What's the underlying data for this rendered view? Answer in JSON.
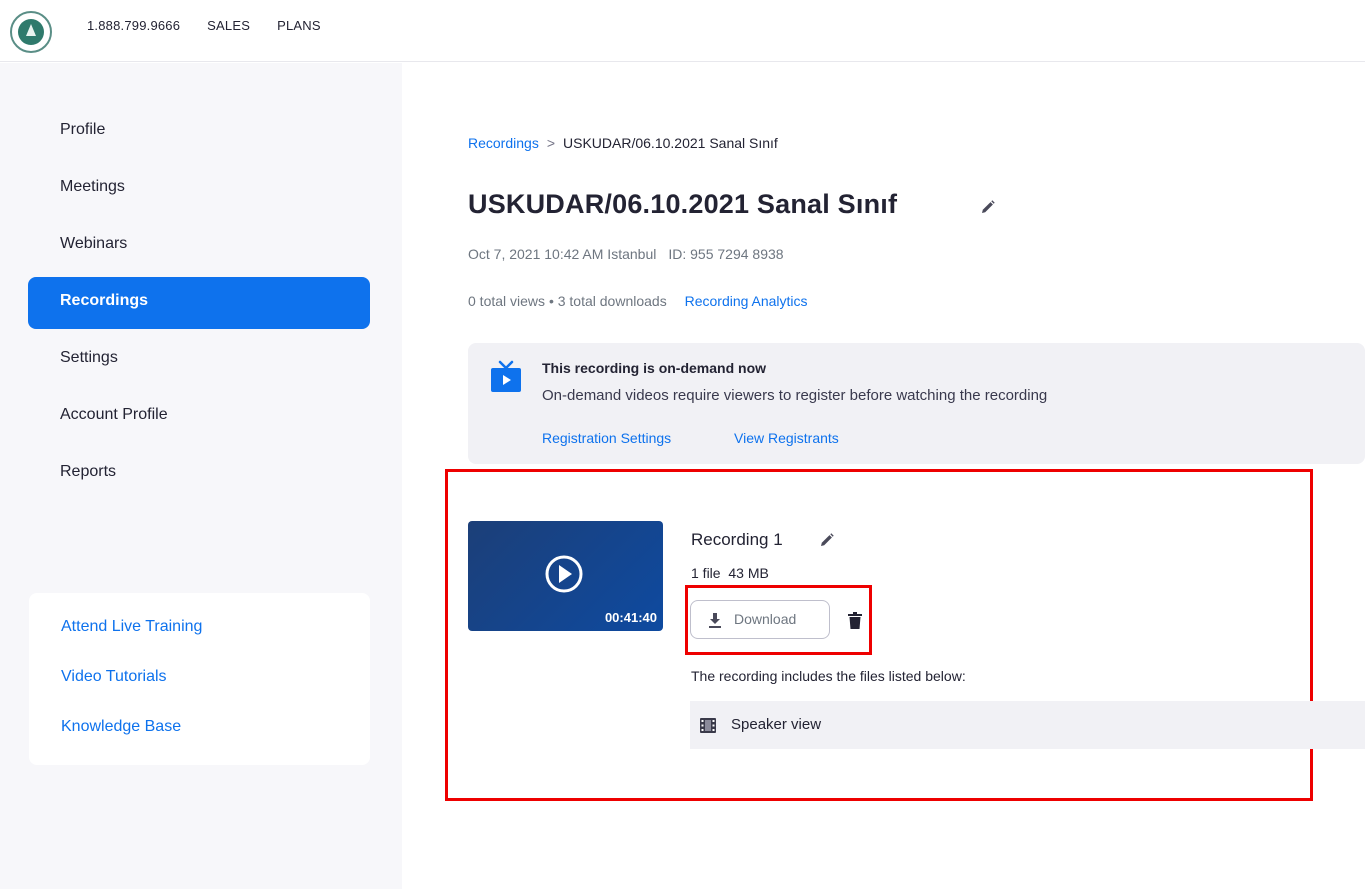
{
  "header": {
    "phone": "1.888.799.9666",
    "sales": "SALES",
    "plans": "PLANS"
  },
  "sidebar": {
    "items": [
      {
        "label": "Profile"
      },
      {
        "label": "Meetings"
      },
      {
        "label": "Webinars"
      },
      {
        "label": "Recordings",
        "active": true
      },
      {
        "label": "Settings"
      },
      {
        "label": "Account Profile"
      },
      {
        "label": "Reports"
      }
    ],
    "help_links": [
      {
        "label": "Attend Live Training"
      },
      {
        "label": "Video Tutorials"
      },
      {
        "label": "Knowledge Base"
      }
    ]
  },
  "breadcrumb": {
    "parent": "Recordings",
    "separator": ">",
    "current": "USKUDAR/06.10.2021 Sanal Sınıf"
  },
  "meeting": {
    "title": "USKUDAR/06.10.2021 Sanal Sınıf",
    "datetime": "Oct 7, 2021 10:42 AM Istanbul",
    "id_text": "ID: 955 7294 8938",
    "views": "0 total views",
    "bullet": "•",
    "downloads": "3 total downloads",
    "analytics_link": "Recording Analytics"
  },
  "on_demand": {
    "title": "This recording is on-demand now",
    "description": "On-demand videos require viewers to register before watching the recording",
    "registration_settings": "Registration Settings",
    "view_registrants": "View Registrants"
  },
  "recording": {
    "name": "Recording 1",
    "file_count": "1 file",
    "size": "43 MB",
    "duration": "00:41:40",
    "download_label": "Download",
    "files_note": "The recording includes the files listed below:",
    "files": [
      {
        "label": "Speaker view"
      }
    ]
  },
  "colors": {
    "accent": "#0e72ed",
    "highlight": "#ee0000",
    "thumbnail": "#0e4aa0"
  }
}
